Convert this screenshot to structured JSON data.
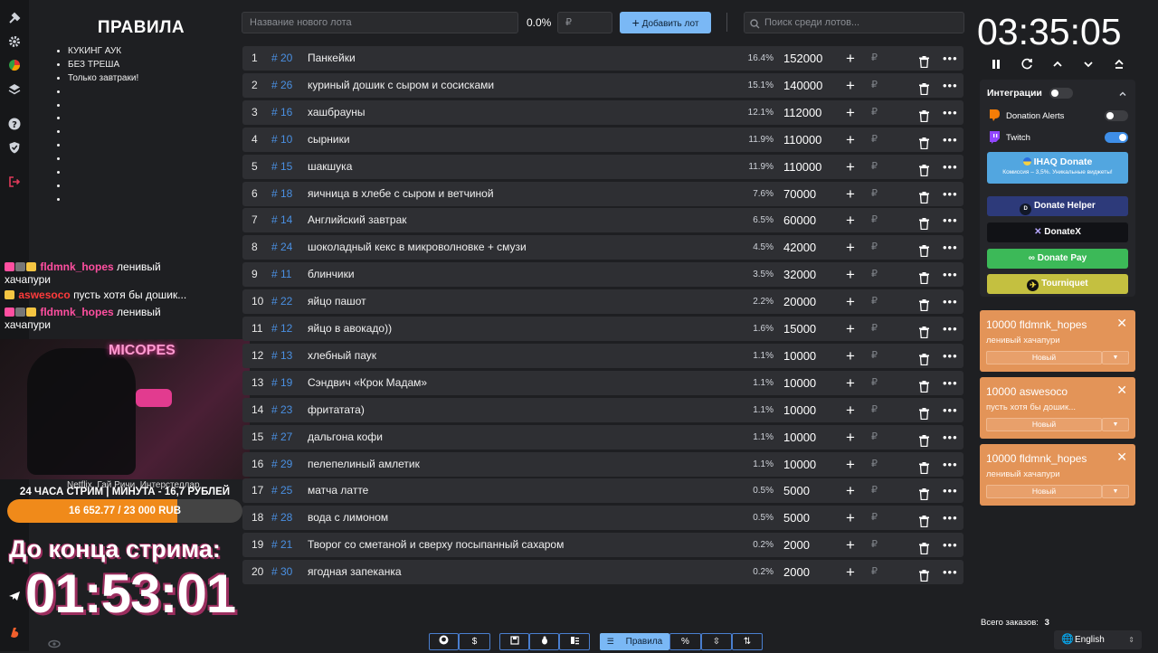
{
  "rules": {
    "title": "ПРАВИЛА",
    "items": [
      "КУКИНГ АУК",
      "БЕЗ ТРЕША",
      "Только завтраки!",
      "",
      "",
      "",
      "",
      "",
      "",
      "",
      "",
      ""
    ]
  },
  "chat": [
    {
      "nick": "fldmnk_hopes",
      "msg": "ленивый",
      "cont": "хачапури"
    },
    {
      "nick": "aswesoco",
      "msg": "пусть хотя бы дошик..."
    },
    {
      "nick": "fldmnk_hopes",
      "msg": "ленивый",
      "cont": "хачапури"
    }
  ],
  "stream": {
    "cam_sign": "MICOPES",
    "caption": "Netflix, Гай Ричи, Интерстеллар",
    "title": "24 ЧАСА СТРИМ | МИНУТА - 16,7 РУБЛЕЙ",
    "progress_text": "16 652.77 / 23 000 RUB",
    "progress_fraction": 0.724,
    "end_label": "До конца стрима:",
    "end_time": "01:53:01"
  },
  "topbar": {
    "new_lot_placeholder": "Название нового лота",
    "percent": "0.0%",
    "currency_placeholder": "₽",
    "add_button": "Добавить лот",
    "search_placeholder": "Поиск среди лотов..."
  },
  "lots": [
    {
      "n": "1",
      "id": "# 20",
      "name": "Панкейки",
      "pct": "16.4%",
      "amount": "152000"
    },
    {
      "n": "2",
      "id": "# 26",
      "name": "куриный дошик с сыром и сосисками",
      "pct": "15.1%",
      "amount": "140000"
    },
    {
      "n": "3",
      "id": "# 16",
      "name": "хашбрауны",
      "pct": "12.1%",
      "amount": "112000"
    },
    {
      "n": "4",
      "id": "# 10",
      "name": "сырники",
      "pct": "11.9%",
      "amount": "110000"
    },
    {
      "n": "5",
      "id": "# 15",
      "name": "шакшука",
      "pct": "11.9%",
      "amount": "110000"
    },
    {
      "n": "6",
      "id": "# 18",
      "name": "яичница в хлебе с сыром и ветчиной",
      "pct": "7.6%",
      "amount": "70000"
    },
    {
      "n": "7",
      "id": "# 14",
      "name": "Английский завтрак",
      "pct": "6.5%",
      "amount": "60000"
    },
    {
      "n": "8",
      "id": "# 24",
      "name": "шоколадный кекс в микроволновке + смузи",
      "pct": "4.5%",
      "amount": "42000"
    },
    {
      "n": "9",
      "id": "# 11",
      "name": "блинчики",
      "pct": "3.5%",
      "amount": "32000"
    },
    {
      "n": "10",
      "id": "# 22",
      "name": "яйцо пашот",
      "pct": "2.2%",
      "amount": "20000"
    },
    {
      "n": "11",
      "id": "# 12",
      "name": "яйцо в авокадо))",
      "pct": "1.6%",
      "amount": "15000"
    },
    {
      "n": "12",
      "id": "# 13",
      "name": "хлебный паук",
      "pct": "1.1%",
      "amount": "10000"
    },
    {
      "n": "13",
      "id": "# 19",
      "name": "Сэндвич «Крок Мадам»",
      "pct": "1.1%",
      "amount": "10000"
    },
    {
      "n": "14",
      "id": "# 23",
      "name": "фритатата)",
      "pct": "1.1%",
      "amount": "10000"
    },
    {
      "n": "15",
      "id": "# 27",
      "name": "дальгона кофи",
      "pct": "1.1%",
      "amount": "10000"
    },
    {
      "n": "16",
      "id": "# 29",
      "name": "пелепелиный амлетик",
      "pct": "1.1%",
      "amount": "10000"
    },
    {
      "n": "17",
      "id": "# 25",
      "name": "матча латте",
      "pct": "0.5%",
      "amount": "5000"
    },
    {
      "n": "18",
      "id": "# 28",
      "name": "вода с лимоном",
      "pct": "0.5%",
      "amount": "5000"
    },
    {
      "n": "19",
      "id": "# 21",
      "name": "Творог со сметаной и сверху посыпанный сахаром",
      "pct": "0.2%",
      "amount": "2000"
    },
    {
      "n": "20",
      "id": "# 30",
      "name": "ягодная запеканка",
      "pct": "0.2%",
      "amount": "2000"
    }
  ],
  "lot_currency": "₽",
  "timer": "03:35:05",
  "integrations": {
    "title": "Интеграции",
    "donation_alerts": "Donation Alerts",
    "twitch": "Twitch",
    "ihaq_title": "IHAQ Donate",
    "ihaq_sub": "Комиссия – 3,5%. Уникальные виджеты!",
    "donate_helper": "Donate Helper",
    "donatex": "DonateX",
    "donate_pay": "Donate Pay",
    "tourniquet": "Tourniquet"
  },
  "donations": [
    {
      "title": "10000 fldmnk_hopes",
      "msg": "ленивый хачапури",
      "status": "Новый"
    },
    {
      "title": "10000 aswesoco",
      "msg": "пусть хотя бы дошик...",
      "status": "Новый"
    },
    {
      "title": "10000 fldmnk_hopes",
      "msg": "ленивый хачапури",
      "status": "Новый"
    }
  ],
  "footer": {
    "orders_label": "Всего заказов:",
    "orders_count": "3",
    "language": "English",
    "rules_tab": "Правила"
  },
  "colors": {
    "accent_blue": "#7ab8f5",
    "donation_card": "#e39458",
    "progress": "#f08a1a",
    "lot_tag": "#4a90e2"
  }
}
